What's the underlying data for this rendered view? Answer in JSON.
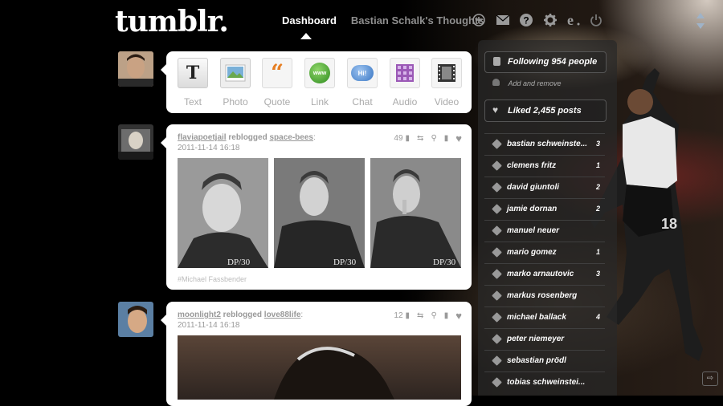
{
  "header": {
    "logo": "tumblr.",
    "nav_dashboard": "Dashboard",
    "nav_blog": "Bastian Schalk's Thoughts",
    "icons": [
      "new-post-icon",
      "messages-icon",
      "help-icon",
      "preferences-icon",
      "customize-icon",
      "logout-icon"
    ]
  },
  "post_types": [
    {
      "label": "Text",
      "icon": "text-icon"
    },
    {
      "label": "Photo",
      "icon": "photo-icon"
    },
    {
      "label": "Quote",
      "icon": "quote-icon"
    },
    {
      "label": "Link",
      "icon": "link-icon"
    },
    {
      "label": "Chat",
      "icon": "chat-icon"
    },
    {
      "label": "Audio",
      "icon": "audio-icon"
    },
    {
      "label": "Video",
      "icon": "video-icon"
    }
  ],
  "link_icon_text": "www",
  "chat_icon_text": "Hi!",
  "posts": [
    {
      "user": "flaviapoetjail",
      "action": "reblogged",
      "source": "space-bees",
      "suffix": ":",
      "date": "2011-11-14 16:18",
      "notes": "49",
      "watermark": "DP/30",
      "tag": "#Michael Fassbender"
    },
    {
      "user": "moonlight2",
      "action": "reblogged",
      "source": "love88life",
      "suffix": ":",
      "date": "2011-11-14 16:18",
      "notes": "12"
    }
  ],
  "sidebar": {
    "following": "Following 954 people",
    "add_remove": "Add and remove",
    "liked": "Liked 2,455 posts",
    "tags": [
      {
        "name": "bastian schweinste...",
        "count": "3"
      },
      {
        "name": "clemens fritz",
        "count": "1"
      },
      {
        "name": "david giuntoli",
        "count": "2"
      },
      {
        "name": "jamie dornan",
        "count": "2"
      },
      {
        "name": "manuel neuer",
        "count": ""
      },
      {
        "name": "mario gomez",
        "count": "1"
      },
      {
        "name": "marko arnautovic",
        "count": "3"
      },
      {
        "name": "markus rosenberg",
        "count": ""
      },
      {
        "name": "michael ballack",
        "count": "4"
      },
      {
        "name": "peter niemeyer",
        "count": ""
      },
      {
        "name": "sebastian prödl",
        "count": ""
      },
      {
        "name": "tobias schweinstei...",
        "count": ""
      }
    ]
  },
  "jersey_number": "18",
  "colors": {
    "background": "#000000",
    "panel": "#ffffff",
    "sidebar": "#2a2a2a"
  }
}
